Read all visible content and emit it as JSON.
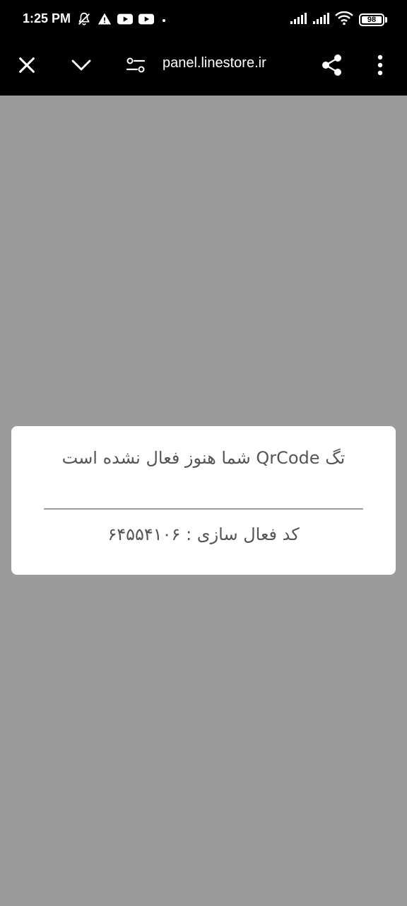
{
  "status_bar": {
    "time": "1:25 PM",
    "battery_level": "98",
    "left_icons": [
      "notifications-off-icon",
      "warning-icon",
      "youtube-icon",
      "youtube-icon",
      "dot-icon"
    ],
    "right_icons": [
      "signal-icon",
      "signal-icon",
      "wifi-icon",
      "battery-icon"
    ]
  },
  "browser_toolbar": {
    "url": "panel.linestore.ir",
    "icons": [
      "close-icon",
      "chevron-down-icon",
      "site-settings-icon",
      "share-icon",
      "more-vert-icon"
    ]
  },
  "dialog": {
    "message": "تگ QrCode شما هنوز فعال نشده است",
    "activation_code_text": "کد فعال سازی : ۶۴۵۵۴۱۰۶"
  },
  "colors": {
    "background": "#9b9b9b",
    "bars": "#000000",
    "dialog_bg": "#ffffff",
    "dialog_text": "#555555",
    "divider": "#9e9e9e"
  }
}
